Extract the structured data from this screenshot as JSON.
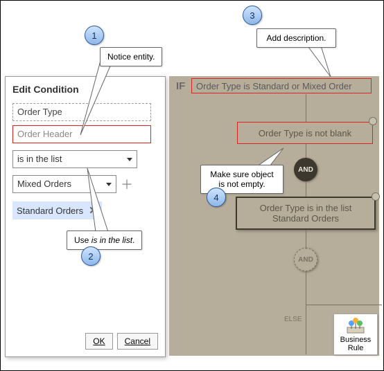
{
  "callouts": {
    "1": {
      "num": "1",
      "text": "Notice entity."
    },
    "2": {
      "num": "2",
      "text": "Use Is in the list."
    },
    "3": {
      "num": "3",
      "text": "Add description."
    },
    "4": {
      "num": "4",
      "text": "Make sure object is not empty."
    }
  },
  "panel": {
    "title": "Edit Condition",
    "field_attribute": "Order Type",
    "field_entity": "Order Header",
    "operator": "is in the list",
    "value_selected": "Mixed Orders",
    "chip": "Standard Orders",
    "ok": "OK",
    "cancel": "Cancel"
  },
  "canvas": {
    "if_label": "IF",
    "if_condition": "Order Type is Standard or Mixed Order",
    "node_notblank": "Order Type is not blank",
    "and": "AND",
    "node_inlist": "Order Type is in the list Standard Orders",
    "else": "ELSE"
  },
  "bizrule": {
    "line1": "Business",
    "line2": "Rule"
  }
}
